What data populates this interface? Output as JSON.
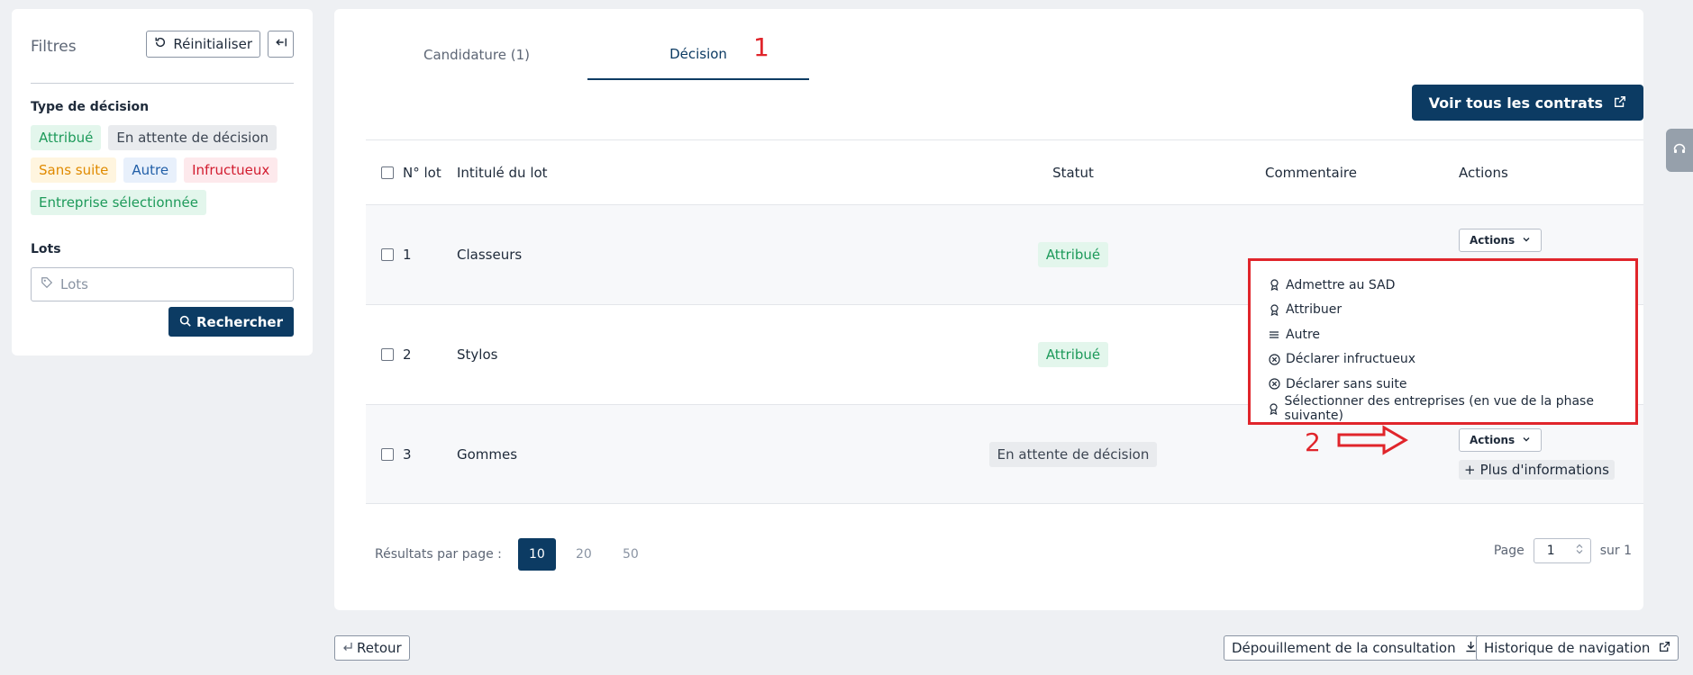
{
  "filters": {
    "title": "Filtres",
    "reset_label": "Réinitialiser",
    "decision_type_label": "Type de décision",
    "chips": [
      "Attribué",
      "En attente de décision",
      "Sans suite",
      "Autre",
      "Infructueux",
      "Entreprise sélectionnée"
    ],
    "lots_label": "Lots",
    "lots_placeholder": "Lots",
    "search_label": "Rechercher"
  },
  "tabs": [
    "Candidature (1)",
    "Décision"
  ],
  "annotations": {
    "one": "1",
    "two": "2"
  },
  "contracts_button": "Voir tous les contrats",
  "table": {
    "headers": {
      "num": "N° lot",
      "title": "Intitulé du lot",
      "status": "Statut",
      "comment": "Commentaire",
      "actions": "Actions"
    },
    "rows": [
      {
        "num": "1",
        "title": "Classeurs",
        "status": "Attribué",
        "actions": "Actions"
      },
      {
        "num": "2",
        "title": "Stylos",
        "status": "Attribué"
      },
      {
        "num": "3",
        "title": "Gommes",
        "status": "En attente de décision",
        "actions": "Actions",
        "more": "Plus d'informations"
      }
    ]
  },
  "dropdown_items": [
    {
      "label": "Admettre au SAD",
      "icon": "award-icon"
    },
    {
      "label": "Attribuer",
      "icon": "award-icon"
    },
    {
      "label": "Autre",
      "icon": "lines-icon"
    },
    {
      "label": "Déclarer infructueux",
      "icon": "x-circle-icon"
    },
    {
      "label": "Déclarer sans suite",
      "icon": "x-circle-icon"
    },
    {
      "label": "Sélectionner des entreprises (en vue de la phase suivante)",
      "icon": "award-icon"
    }
  ],
  "pagination": {
    "results_label": "Résultats par page :",
    "sizes": [
      "10",
      "20",
      "50"
    ],
    "page_label": "Page",
    "page_value": "1",
    "of_label": "sur 1"
  },
  "bottom": {
    "back": "Retour",
    "depouillement": "Dépouillement de la consultation",
    "history": "Historique de navigation"
  }
}
